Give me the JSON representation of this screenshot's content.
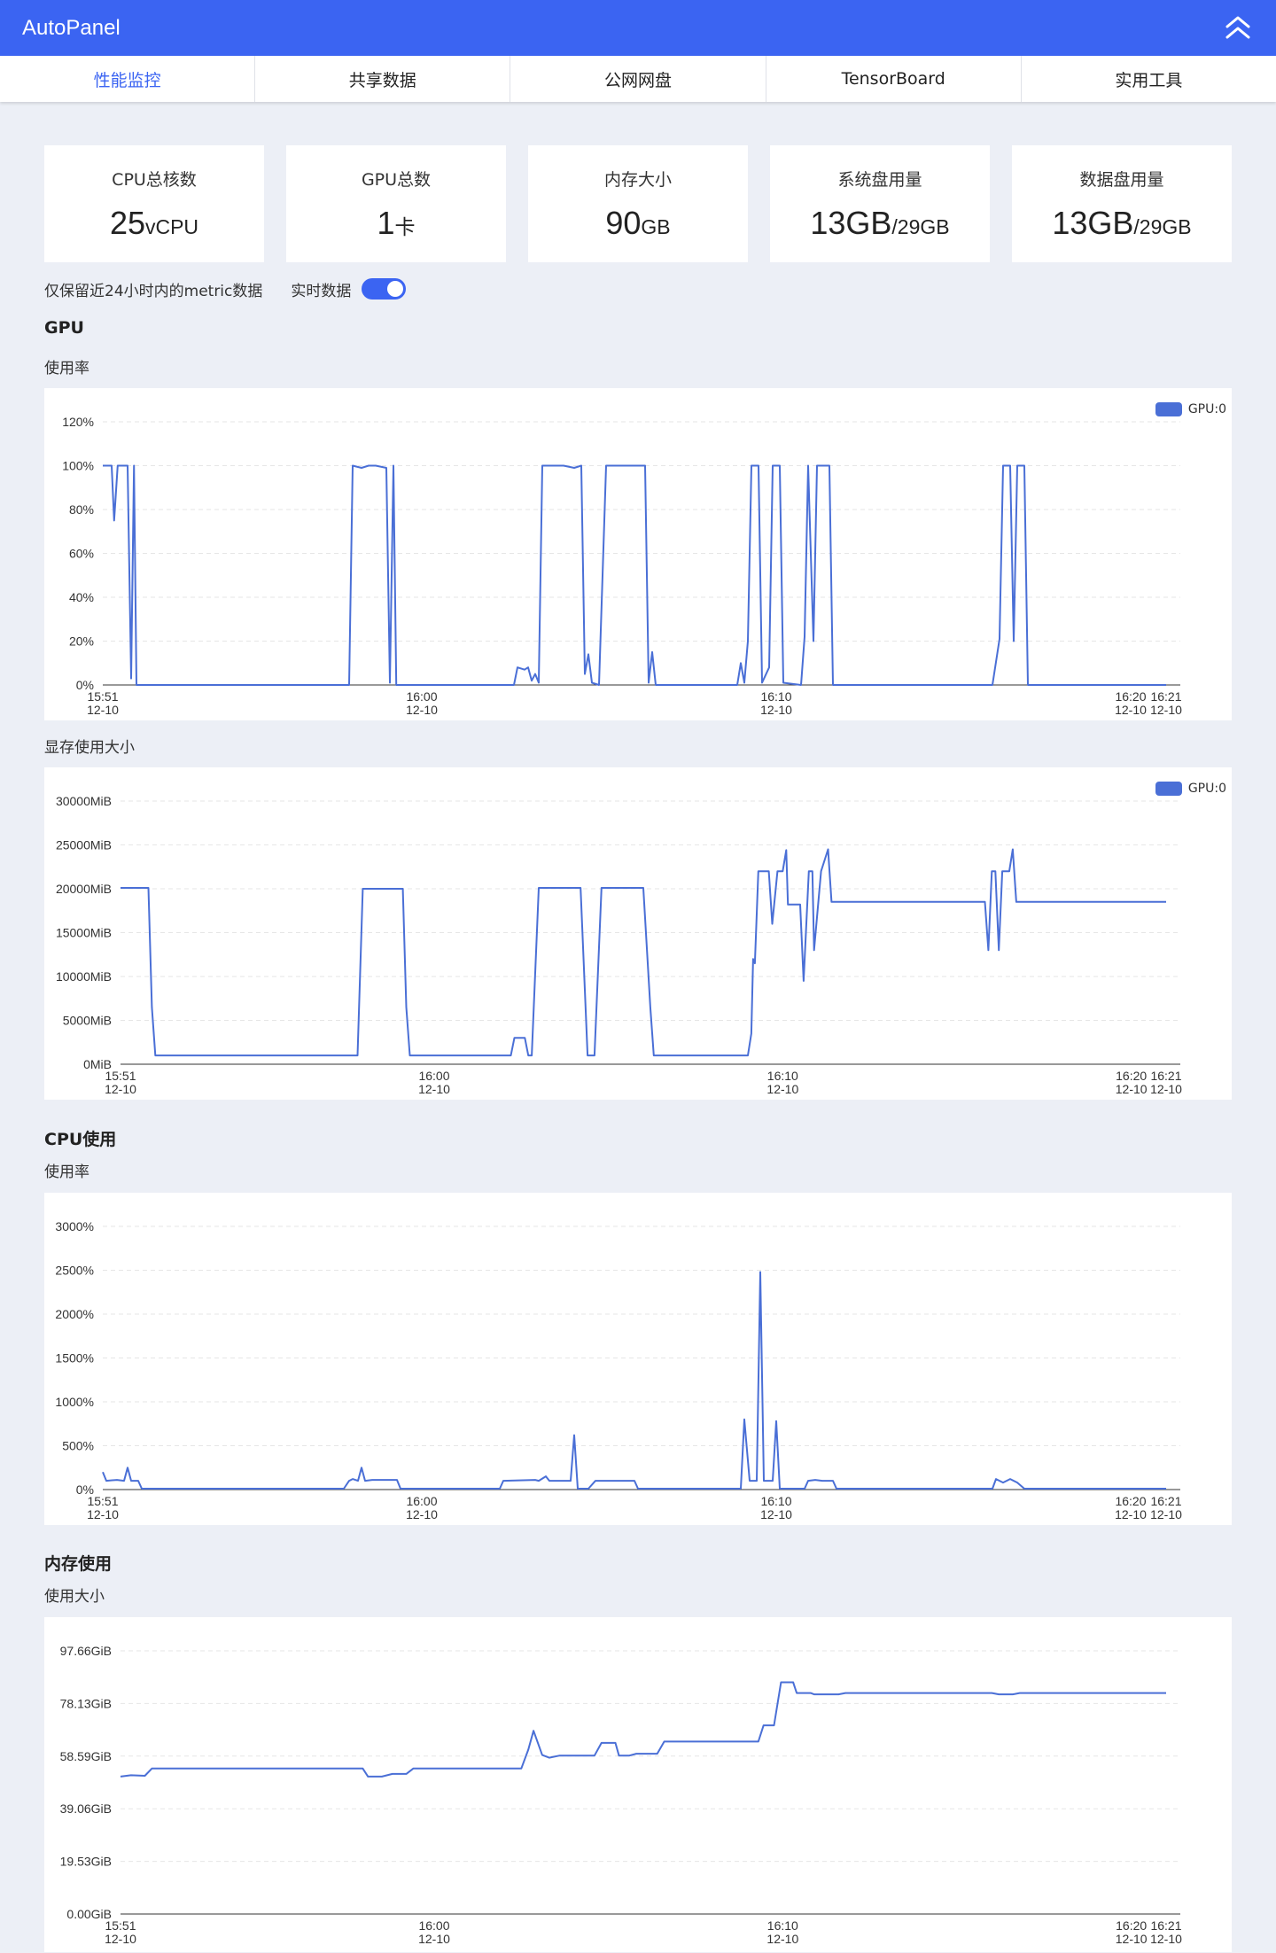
{
  "app": {
    "title": "AutoPanel",
    "accent": "#3b64f2",
    "line_color": "#4a6fd6",
    "collapse_icon": "double-chevron-up-icon"
  },
  "tabs": [
    {
      "label": "性能监控",
      "active": true
    },
    {
      "label": "共享数据",
      "active": false
    },
    {
      "label": "公网网盘",
      "active": false
    },
    {
      "label": "TensorBoard",
      "active": false
    },
    {
      "label": "实用工具",
      "active": false
    }
  ],
  "stats": [
    {
      "label": "CPU总核数",
      "value": "25",
      "unit": "vCPU"
    },
    {
      "label": "GPU总数",
      "value": "1",
      "unit": "卡"
    },
    {
      "label": "内存大小",
      "value": "90",
      "unit": "GB"
    },
    {
      "label": "系统盘用量",
      "value": "13GB",
      "unit": "/29GB"
    },
    {
      "label": "数据盘用量",
      "value": "13GB",
      "unit": "/29GB"
    }
  ],
  "options": {
    "retention_note": "仅保留近24小时内的metric数据",
    "realtime_label": "实时数据",
    "realtime_on": true
  },
  "sections": {
    "gpu": "GPU",
    "cpu": "CPU使用",
    "memory": "内存使用"
  },
  "subtitles": {
    "gpu_util": "使用率",
    "gpu_mem": "显存使用大小",
    "cpu_util": "使用率",
    "mem_used": "使用大小"
  },
  "chart_data": [
    {
      "id": "gpu_util",
      "type": "line",
      "legend": "GPU:0",
      "y_ticks": [
        "0%",
        "20%",
        "40%",
        "60%",
        "80%",
        "100%",
        "120%"
      ],
      "ylim": [
        0,
        120
      ],
      "xlim": [
        0,
        30
      ],
      "x_ticks": [
        {
          "t": 0,
          "time": "15:51",
          "date": "12-10"
        },
        {
          "t": 9,
          "time": "16:00",
          "date": "12-10"
        },
        {
          "t": 19,
          "time": "16:10",
          "date": "12-10"
        },
        {
          "t": 29,
          "time": "16:20",
          "date": "12-10"
        },
        {
          "t": 30,
          "time": "16:21",
          "date": "12-10"
        }
      ],
      "grid": true,
      "points": [
        [
          0,
          100
        ],
        [
          0.25,
          100
        ],
        [
          0.32,
          75
        ],
        [
          0.42,
          100
        ],
        [
          0.7,
          100
        ],
        [
          0.8,
          3
        ],
        [
          0.88,
          100
        ],
        [
          0.95,
          0
        ],
        [
          6.95,
          0
        ],
        [
          7.05,
          100
        ],
        [
          7.3,
          99
        ],
        [
          7.5,
          100
        ],
        [
          7.7,
          100
        ],
        [
          8.0,
          99
        ],
        [
          8.1,
          1
        ],
        [
          8.2,
          100
        ],
        [
          8.28,
          0
        ],
        [
          11.6,
          0
        ],
        [
          11.7,
          8
        ],
        [
          11.9,
          7
        ],
        [
          12.0,
          8
        ],
        [
          12.1,
          2
        ],
        [
          12.2,
          5
        ],
        [
          12.3,
          1
        ],
        [
          12.4,
          100
        ],
        [
          13.0,
          100
        ],
        [
          13.3,
          99
        ],
        [
          13.5,
          100
        ],
        [
          13.6,
          5
        ],
        [
          13.7,
          14
        ],
        [
          13.8,
          1
        ],
        [
          14.0,
          0
        ],
        [
          14.2,
          100
        ],
        [
          15.3,
          100
        ],
        [
          15.4,
          1
        ],
        [
          15.5,
          15
        ],
        [
          15.6,
          0
        ],
        [
          17.9,
          0
        ],
        [
          18.0,
          10
        ],
        [
          18.1,
          1
        ],
        [
          18.2,
          20
        ],
        [
          18.3,
          100
        ],
        [
          18.5,
          100
        ],
        [
          18.6,
          1
        ],
        [
          18.8,
          8
        ],
        [
          18.9,
          100
        ],
        [
          19.1,
          100
        ],
        [
          19.2,
          1
        ],
        [
          19.7,
          0
        ],
        [
          19.8,
          22
        ],
        [
          19.9,
          100
        ],
        [
          20.05,
          20
        ],
        [
          20.15,
          100
        ],
        [
          20.5,
          100
        ],
        [
          20.6,
          0
        ],
        [
          25.1,
          0
        ],
        [
          25.3,
          21
        ],
        [
          25.4,
          100
        ],
        [
          25.6,
          100
        ],
        [
          25.7,
          20
        ],
        [
          25.8,
          100
        ],
        [
          26.0,
          100
        ],
        [
          26.1,
          0
        ],
        [
          30,
          0
        ]
      ]
    },
    {
      "id": "gpu_mem",
      "type": "line",
      "legend": "GPU:0",
      "y_ticks": [
        "0MiB",
        "5000MiB",
        "10000MiB",
        "15000MiB",
        "20000MiB",
        "25000MiB",
        "30000MiB"
      ],
      "ylim": [
        0,
        30000
      ],
      "xlim": [
        0,
        30
      ],
      "x_ticks": [
        {
          "t": 0,
          "time": "15:51",
          "date": "12-10"
        },
        {
          "t": 9,
          "time": "16:00",
          "date": "12-10"
        },
        {
          "t": 19,
          "time": "16:10",
          "date": "12-10"
        },
        {
          "t": 29,
          "time": "16:20",
          "date": "12-10"
        },
        {
          "t": 30,
          "time": "16:21",
          "date": "12-10"
        }
      ],
      "grid": true,
      "points": [
        [
          0,
          20100
        ],
        [
          0.8,
          20100
        ],
        [
          0.9,
          6500
        ],
        [
          1.0,
          1000
        ],
        [
          6.8,
          1000
        ],
        [
          6.95,
          20000
        ],
        [
          8.1,
          20000
        ],
        [
          8.2,
          6500
        ],
        [
          8.3,
          1000
        ],
        [
          11.2,
          1000
        ],
        [
          11.3,
          3000
        ],
        [
          11.6,
          3000
        ],
        [
          11.7,
          1000
        ],
        [
          11.8,
          1000
        ],
        [
          12.0,
          20100
        ],
        [
          13.2,
          20100
        ],
        [
          13.4,
          1000
        ],
        [
          13.6,
          1000
        ],
        [
          13.8,
          20100
        ],
        [
          15.0,
          20100
        ],
        [
          15.2,
          6500
        ],
        [
          15.3,
          1000
        ],
        [
          18.0,
          1000
        ],
        [
          18.1,
          3500
        ],
        [
          18.15,
          12000
        ],
        [
          18.2,
          11500
        ],
        [
          18.3,
          22000
        ],
        [
          18.6,
          22000
        ],
        [
          18.7,
          16000
        ],
        [
          18.85,
          22000
        ],
        [
          19.0,
          22000
        ],
        [
          19.1,
          24400
        ],
        [
          19.15,
          18200
        ],
        [
          19.5,
          18200
        ],
        [
          19.6,
          9500
        ],
        [
          19.75,
          22000
        ],
        [
          19.85,
          22000
        ],
        [
          19.9,
          13000
        ],
        [
          20.1,
          22000
        ],
        [
          20.3,
          24500
        ],
        [
          20.4,
          18500
        ],
        [
          24.8,
          18500
        ],
        [
          24.9,
          13000
        ],
        [
          25.0,
          22000
        ],
        [
          25.1,
          22000
        ],
        [
          25.2,
          13000
        ],
        [
          25.3,
          22000
        ],
        [
          25.5,
          22000
        ],
        [
          25.6,
          24500
        ],
        [
          25.7,
          18500
        ],
        [
          30,
          18500
        ]
      ]
    },
    {
      "id": "cpu_util",
      "type": "line",
      "y_ticks": [
        "0%",
        "500%",
        "1000%",
        "1500%",
        "2000%",
        "2500%",
        "3000%"
      ],
      "ylim": [
        0,
        3000
      ],
      "xlim": [
        0,
        30
      ],
      "x_ticks": [
        {
          "t": 0,
          "time": "15:51",
          "date": "12-10"
        },
        {
          "t": 9,
          "time": "16:00",
          "date": "12-10"
        },
        {
          "t": 19,
          "time": "16:10",
          "date": "12-10"
        },
        {
          "t": 29,
          "time": "16:20",
          "date": "12-10"
        },
        {
          "t": 30,
          "time": "16:21",
          "date": "12-10"
        }
      ],
      "grid": true,
      "points": [
        [
          0,
          200
        ],
        [
          0.1,
          100
        ],
        [
          0.4,
          110
        ],
        [
          0.6,
          100
        ],
        [
          0.7,
          250
        ],
        [
          0.8,
          100
        ],
        [
          1.0,
          100
        ],
        [
          1.1,
          10
        ],
        [
          6.8,
          10
        ],
        [
          6.95,
          100
        ],
        [
          7.05,
          120
        ],
        [
          7.2,
          100
        ],
        [
          7.3,
          250
        ],
        [
          7.4,
          100
        ],
        [
          7.6,
          110
        ],
        [
          8.3,
          110
        ],
        [
          8.4,
          10
        ],
        [
          11.2,
          10
        ],
        [
          11.3,
          100
        ],
        [
          12.2,
          110
        ],
        [
          12.3,
          100
        ],
        [
          12.5,
          150
        ],
        [
          12.6,
          100
        ],
        [
          13.2,
          100
        ],
        [
          13.3,
          620
        ],
        [
          13.4,
          10
        ],
        [
          13.7,
          10
        ],
        [
          13.9,
          100
        ],
        [
          15.0,
          100
        ],
        [
          15.1,
          10
        ],
        [
          18.0,
          10
        ],
        [
          18.1,
          800
        ],
        [
          18.25,
          100
        ],
        [
          18.45,
          100
        ],
        [
          18.55,
          2480
        ],
        [
          18.65,
          100
        ],
        [
          18.9,
          100
        ],
        [
          19.0,
          780
        ],
        [
          19.1,
          10
        ],
        [
          19.8,
          10
        ],
        [
          19.9,
          100
        ],
        [
          20.1,
          110
        ],
        [
          20.3,
          100
        ],
        [
          20.6,
          100
        ],
        [
          20.7,
          10
        ],
        [
          25.1,
          10
        ],
        [
          25.2,
          120
        ],
        [
          25.4,
          80
        ],
        [
          25.6,
          120
        ],
        [
          25.8,
          80
        ],
        [
          26.0,
          10
        ],
        [
          30,
          10
        ]
      ]
    },
    {
      "id": "mem_used",
      "type": "line",
      "y_ticks": [
        "0.00GiB",
        "19.53GiB",
        "39.06GiB",
        "58.59GiB",
        "78.13GiB",
        "97.66GiB"
      ],
      "ylim": [
        0,
        97.66
      ],
      "xlim": [
        0,
        30
      ],
      "x_ticks": [
        {
          "t": 0,
          "time": "15:51",
          "date": "12-10"
        },
        {
          "t": 9,
          "time": "16:00",
          "date": "12-10"
        },
        {
          "t": 19,
          "time": "16:10",
          "date": "12-10"
        },
        {
          "t": 29,
          "time": "16:20",
          "date": "12-10"
        },
        {
          "t": 30,
          "time": "16:21",
          "date": "12-10"
        }
      ],
      "grid": true,
      "points": [
        [
          0,
          51
        ],
        [
          0.3,
          51.5
        ],
        [
          0.7,
          51.3
        ],
        [
          0.9,
          54
        ],
        [
          6.95,
          54
        ],
        [
          7.1,
          51
        ],
        [
          7.5,
          51
        ],
        [
          7.8,
          52
        ],
        [
          8.2,
          52
        ],
        [
          8.4,
          54
        ],
        [
          11.5,
          54
        ],
        [
          11.7,
          61
        ],
        [
          11.85,
          68
        ],
        [
          12.1,
          59
        ],
        [
          12.3,
          58
        ],
        [
          12.6,
          58.8
        ],
        [
          13.6,
          58.8
        ],
        [
          13.8,
          63.5
        ],
        [
          14.2,
          63.5
        ],
        [
          14.3,
          58.8
        ],
        [
          14.6,
          58.8
        ],
        [
          14.8,
          59.5
        ],
        [
          15.4,
          59.5
        ],
        [
          15.6,
          64
        ],
        [
          18.3,
          64
        ],
        [
          18.45,
          70
        ],
        [
          18.75,
          70
        ],
        [
          18.95,
          86
        ],
        [
          19.3,
          86
        ],
        [
          19.4,
          82
        ],
        [
          19.8,
          82
        ],
        [
          19.9,
          81.5
        ],
        [
          20.6,
          81.5
        ],
        [
          20.8,
          82
        ],
        [
          25.0,
          82
        ],
        [
          25.2,
          81.5
        ],
        [
          25.6,
          81.5
        ],
        [
          25.8,
          82
        ],
        [
          30,
          82
        ]
      ]
    }
  ]
}
